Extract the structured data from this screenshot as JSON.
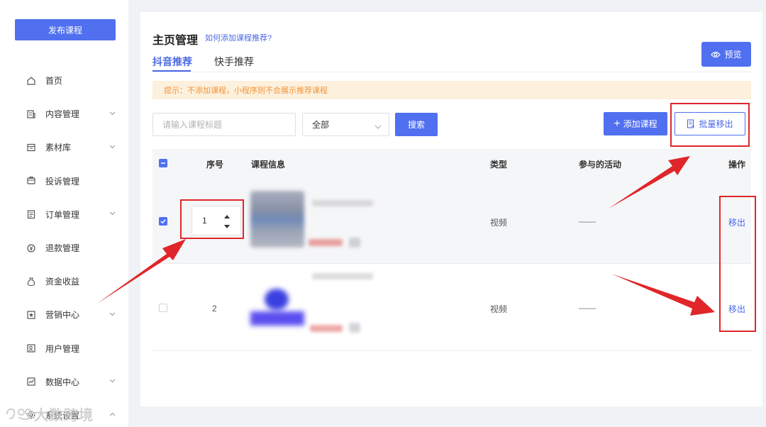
{
  "sidebar": {
    "publish_label": "发布课程",
    "items": [
      {
        "label": "首页",
        "icon": "home-icon",
        "has_submenu": false
      },
      {
        "label": "内容管理",
        "icon": "content-icon",
        "has_submenu": true
      },
      {
        "label": "素材库",
        "icon": "folder-icon",
        "has_submenu": true
      },
      {
        "label": "投诉管理",
        "icon": "complaint-icon",
        "has_submenu": false
      },
      {
        "label": "订单管理",
        "icon": "order-icon",
        "has_submenu": true
      },
      {
        "label": "退款管理",
        "icon": "refund-icon",
        "has_submenu": false
      },
      {
        "label": "资金收益",
        "icon": "money-bag-icon",
        "has_submenu": false
      },
      {
        "label": "营销中心",
        "icon": "marketing-icon",
        "has_submenu": true
      },
      {
        "label": "用户管理",
        "icon": "user-icon",
        "has_submenu": false
      },
      {
        "label": "数据中心",
        "icon": "chart-icon",
        "has_submenu": true
      },
      {
        "label": "系统设置",
        "icon": "settings-icon",
        "has_submenu": true
      }
    ]
  },
  "watermark": "大数跨境",
  "header": {
    "title": "主页管理",
    "help_link": "如何添加课程推荐?",
    "preview_label": "预览"
  },
  "tabs": [
    {
      "label": "抖音推荐",
      "active": true
    },
    {
      "label": "快手推荐",
      "active": false
    }
  ],
  "tip": "提示：不添加课程，小程序则不会展示推荐课程",
  "filters": {
    "search_placeholder": "请输入课程标题",
    "category_value": "全部",
    "search_label": "搜索",
    "add_label": "添加课程",
    "batch_remove_label": "批量移出"
  },
  "table": {
    "columns": [
      "序号",
      "课程信息",
      "类型",
      "参与的活动",
      "操作"
    ],
    "rows": [
      {
        "selected": true,
        "seq": "1",
        "type": "视频",
        "activity": "——",
        "action": "移出"
      },
      {
        "selected": false,
        "seq": "2",
        "type": "视频",
        "activity": "——",
        "action": "移出"
      }
    ]
  },
  "colors": {
    "primary": "#5070f0",
    "link": "#4a68e8",
    "tip_bg": "#fdf0dc",
    "tip_text": "#f0963c",
    "annotation_red": "#e0262a"
  }
}
